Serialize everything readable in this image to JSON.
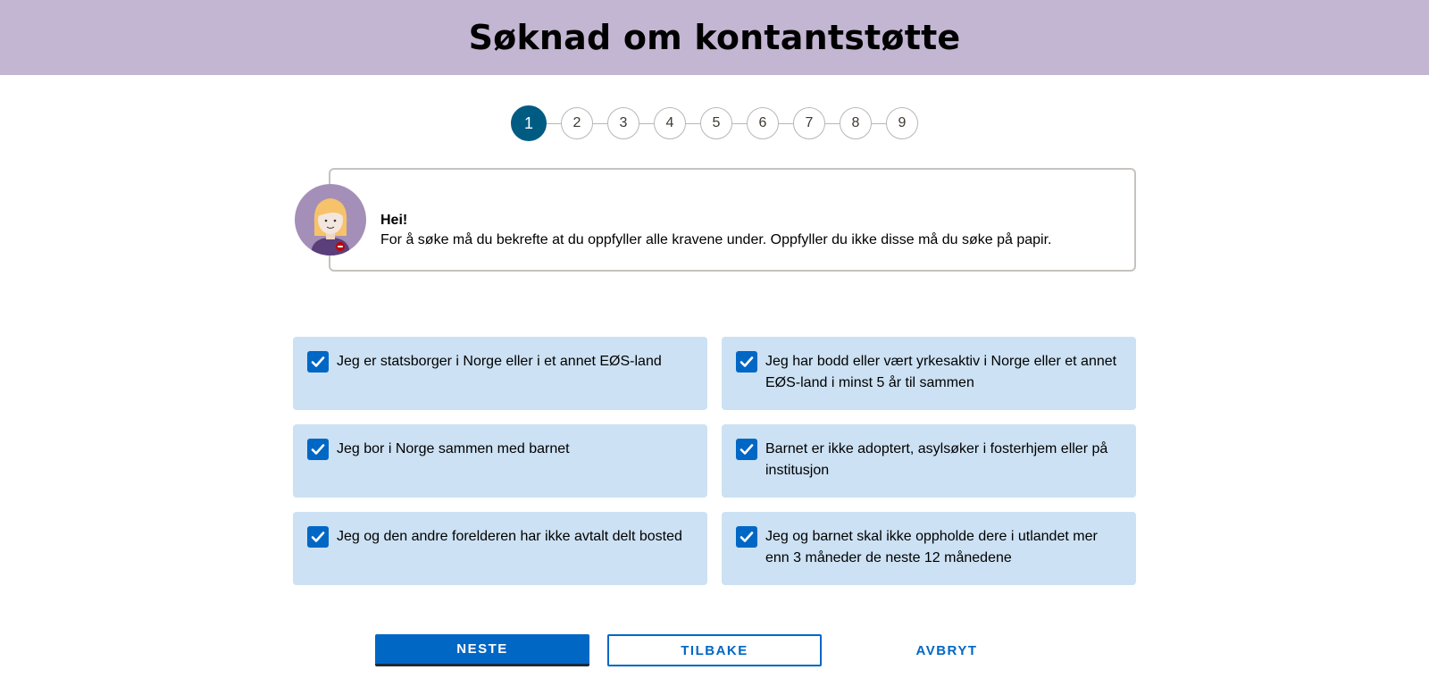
{
  "header": {
    "title": "Søknad om kontantstøtte"
  },
  "stepper": {
    "steps": [
      "1",
      "2",
      "3",
      "4",
      "5",
      "6",
      "7",
      "8",
      "9"
    ],
    "active_step": "1"
  },
  "speech": {
    "greeting": "Hei!",
    "message": "For å søke må du bekrefte at du oppfyller alle kravene under. Oppfyller du ikke disse må du søke på papir."
  },
  "checkboxes": [
    {
      "label": "Jeg er statsborger i Norge eller i et annet EØS-land",
      "checked": true
    },
    {
      "label": "Jeg har bodd eller vært yrkesaktiv i Norge eller et annet EØS-land i minst 5 år til sammen",
      "checked": true
    },
    {
      "label": "Jeg bor i Norge sammen med barnet",
      "checked": true
    },
    {
      "label": "Barnet er ikke adoptert, asylsøker i fosterhjem eller på institusjon",
      "checked": true
    },
    {
      "label": "Jeg og den andre forelderen har ikke avtalt delt bosted",
      "checked": true
    },
    {
      "label": "Jeg og barnet skal ikke oppholde dere i utlandet mer enn 3 måneder de neste 12 månedene",
      "checked": true
    }
  ],
  "buttons": {
    "next": "NESTE",
    "back": "TILBAKE",
    "cancel": "AVBRYT"
  },
  "colors": {
    "header_bg": "#c3b6d2",
    "active_step": "#005b82",
    "card_bg": "#cce1f3",
    "primary": "#0067c5"
  }
}
